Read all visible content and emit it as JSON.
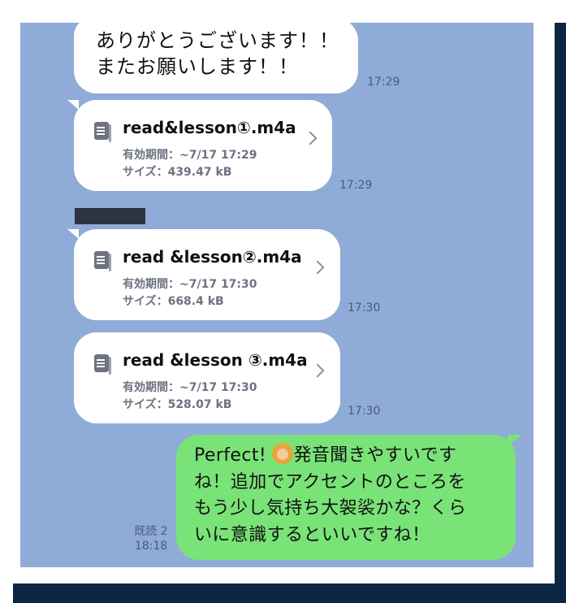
{
  "messages": {
    "m1": {
      "line1": "ありがとうございます！！",
      "line2": "またお願いします！！",
      "time": "17:29"
    },
    "f1": {
      "name": "read&lesson①.m4a",
      "expiry": "有効期間：~7/17 17:29",
      "size": "サイズ：439.47 kB",
      "time": "17:29"
    },
    "f2": {
      "name": "read &lesson②.m4a",
      "expiry": "有効期間：~7/17 17:30",
      "size": "サイズ：668.4 kB",
      "time": "17:30"
    },
    "f3": {
      "name": "read &lesson ③.m4a",
      "expiry": "有効期間：~7/17 17:30",
      "size": "サイズ：528.07 kB",
      "time": "17:30"
    },
    "reply": {
      "line1_prefix": "Perfect! ",
      "emoji": "person-gesturing-ok-icon",
      "line1_suffix": "発音聞きやすいです",
      "line2": "ね！追加でアクセントのところを",
      "line3": "もう少し気持ち大袈裟かな？くら",
      "line4": "いに意識するといいですね！",
      "read_status": "既読 2",
      "time": "18:18"
    }
  },
  "colors": {
    "chat_background": "#8fabd8",
    "incoming_bubble": "#ffffff",
    "outgoing_bubble": "#79e378",
    "frame": "#0d2743"
  }
}
